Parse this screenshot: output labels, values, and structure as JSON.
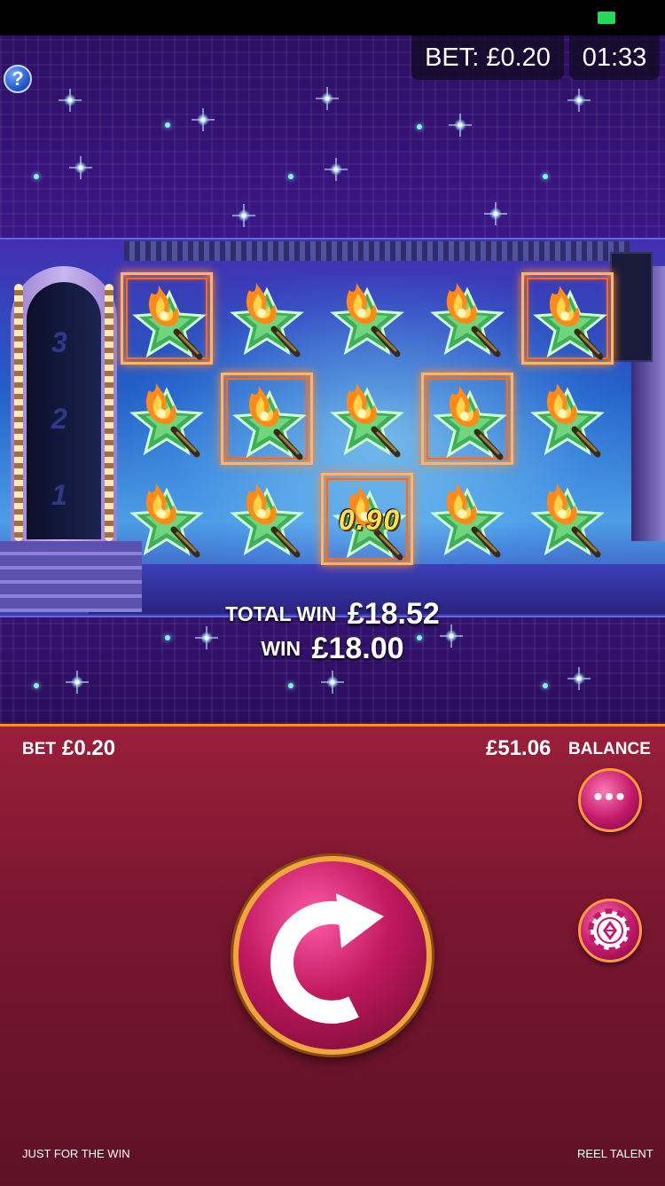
{
  "header": {
    "bet_display": "BET: £0.20",
    "clock": "01:33",
    "help_icon": "question-icon",
    "help_glyph": "?"
  },
  "reels": {
    "symbol": "flaming-star-symbol",
    "highlighted_cells": [
      [
        true,
        false,
        false,
        false,
        true
      ],
      [
        false,
        true,
        false,
        true,
        false
      ],
      [
        false,
        false,
        true,
        false,
        false
      ]
    ],
    "cell_values": [
      [
        "",
        "",
        "",
        "",
        ""
      ],
      [
        "",
        "",
        "",
        "",
        ""
      ],
      [
        "",
        "",
        "0.90",
        "",
        ""
      ]
    ]
  },
  "stage": {
    "door_numbers": [
      "3",
      "2",
      "1"
    ]
  },
  "win": {
    "total_label": "TOTAL WIN",
    "total_amount": "£18.52",
    "win_label": "WIN",
    "win_amount": "£18.00"
  },
  "panel": {
    "bet_label": "BET",
    "bet_value": "£0.20",
    "balance_value": "£51.06",
    "balance_label": "BALANCE",
    "menu_glyph": "•••",
    "menu_icon": "more-dots-icon",
    "chip_icon": "bet-chip-icon",
    "spin_icon": "spin-arrow-icon"
  },
  "footer": {
    "game_name": "JUST FOR THE WIN",
    "provider": "REEL TALENT"
  },
  "colors": {
    "panel": "#7a1630",
    "highlight": "#ffb46a",
    "sky": "#3b1787"
  }
}
